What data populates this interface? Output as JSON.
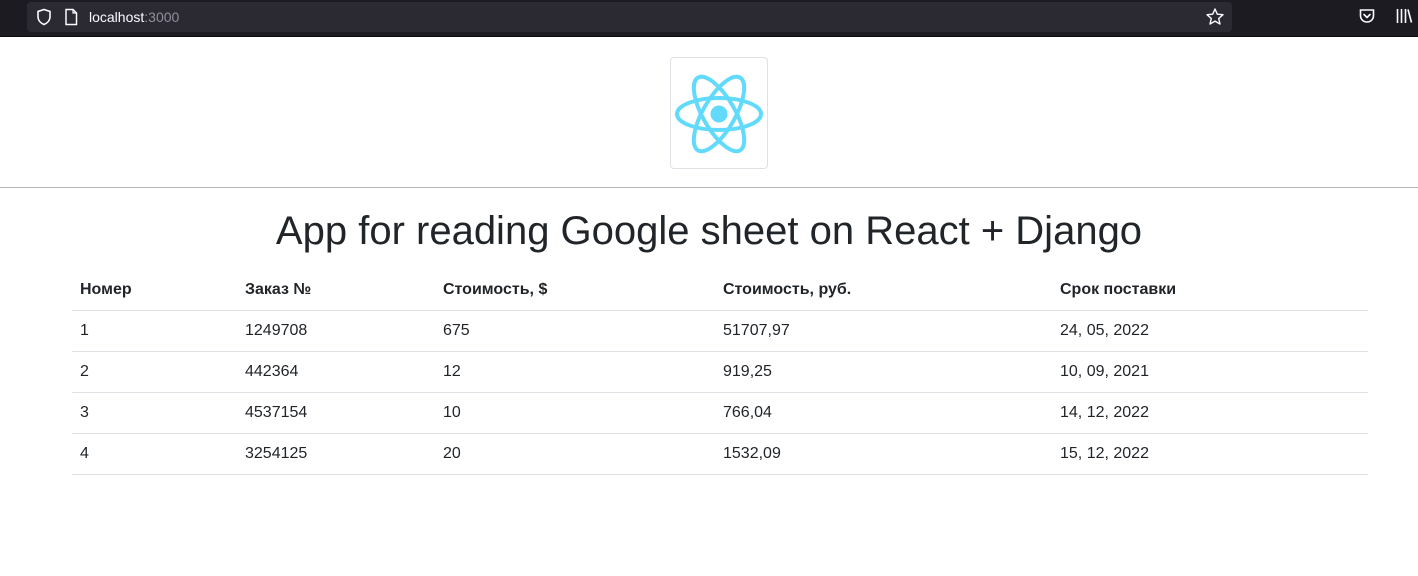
{
  "browser": {
    "url_host": "localhost",
    "url_port": ":3000"
  },
  "page": {
    "title": "App for reading Google sheet on React + Django"
  },
  "table": {
    "headers": [
      "Номер",
      "Заказ №",
      "Стоимость, $",
      "Стоимость, руб.",
      "Срок поставки"
    ],
    "rows": [
      [
        "1",
        "1249708",
        "675",
        "51707,97",
        "24, 05, 2022"
      ],
      [
        "2",
        "442364",
        "12",
        "919,25",
        "10, 09, 2021"
      ],
      [
        "3",
        "4537154",
        "10",
        "766,04",
        "14, 12, 2022"
      ],
      [
        "4",
        "3254125",
        "20",
        "1532,09",
        "15, 12, 2022"
      ]
    ]
  },
  "colors": {
    "react_logo": "#61dafb",
    "browser_bar": "#1c1b22"
  },
  "icons": [
    "shield-icon",
    "page-icon",
    "star-icon",
    "pocket-icon",
    "library-icon",
    "react-logo-icon"
  ]
}
